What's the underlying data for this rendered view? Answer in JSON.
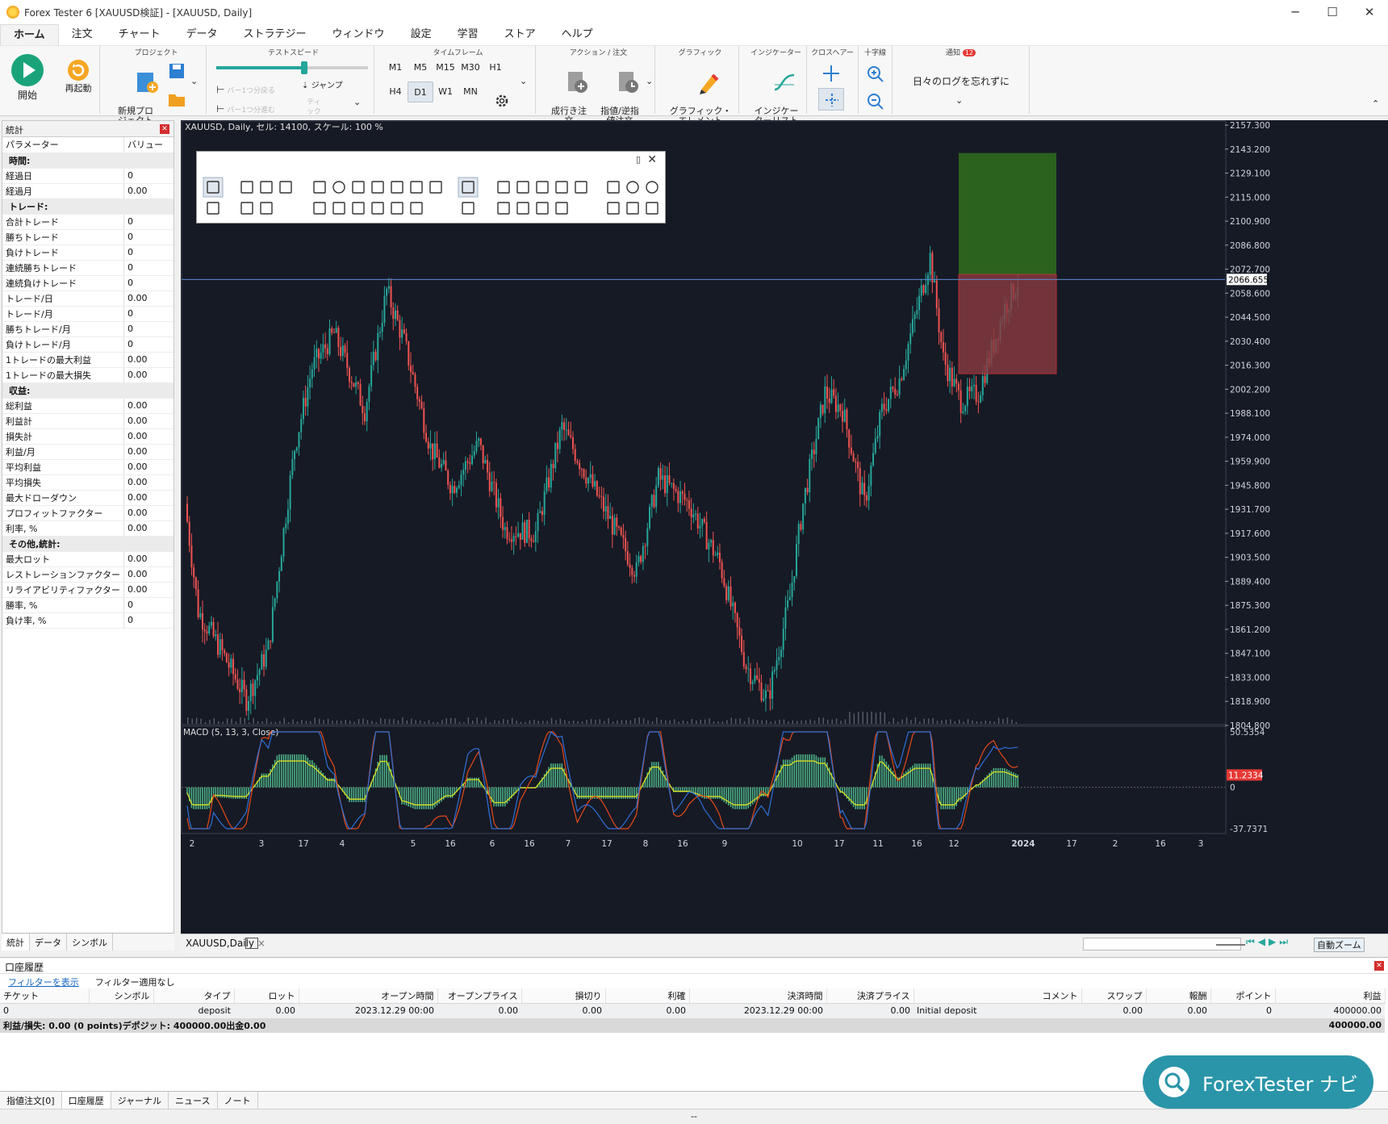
{
  "window": {
    "title": "Forex Tester 6  [XAUUSD検証] - [XAUUSD, Daily]"
  },
  "menu": [
    "ホーム",
    "注文",
    "チャート",
    "データ",
    "ストラテジー",
    "ウィンドウ",
    "設定",
    "学習",
    "ストア",
    "ヘルプ"
  ],
  "ribbon": {
    "start": "開始",
    "restart": "再起動",
    "group_project": "プロジェクト",
    "new_project": "新規プロ\nジェクト",
    "group_speed": "テストスピード",
    "bar_back": "バー1つ分戻る",
    "bar_fwd": "バー1つ分進む",
    "jump": "ジャンプ",
    "tick": "ティ\nック",
    "group_tf": "タイムフレーム",
    "timeframes": [
      "M1",
      "M5",
      "M15",
      "M30",
      "H1",
      "H4",
      "D1",
      "W1",
      "MN"
    ],
    "selected_tf": "D1",
    "group_action": "アクション / 注文",
    "market_order": "成行き注\n文",
    "limit_stop": "指値/逆指\n値注文",
    "group_graphic": "グラフィック",
    "graphic_elements": "グラフィック・\nエレメント",
    "group_indicator": "インジケーター",
    "indicator_list": "インジケー\nターリスト",
    "group_cross": "クロスヘアー",
    "group_crosshair": "十字線",
    "group_notify": "通知",
    "notify_badge": "12",
    "notify_text": "日々のログを忘れずに"
  },
  "stats": {
    "title": "統計",
    "col_param": "パラメーター",
    "col_value": "バリュー",
    "rows": [
      {
        "s": "時間:"
      },
      {
        "p": "経過日",
        "v": "0"
      },
      {
        "p": "経過月",
        "v": "0.00"
      },
      {
        "s": "トレード:"
      },
      {
        "p": "合計トレード",
        "v": "0"
      },
      {
        "p": "勝ちトレード",
        "v": "0"
      },
      {
        "p": "負けトレード",
        "v": "0"
      },
      {
        "p": "連続勝ちトレード",
        "v": "0"
      },
      {
        "p": "連続負けトレード",
        "v": "0"
      },
      {
        "p": "トレード/日",
        "v": "0.00"
      },
      {
        "p": "トレード/月",
        "v": "0"
      },
      {
        "p": "勝ちトレード/月",
        "v": "0"
      },
      {
        "p": "負けトレード/月",
        "v": "0"
      },
      {
        "p": "1トレードの最大利益",
        "v": "0.00"
      },
      {
        "p": "1トレードの最大損失",
        "v": "0.00"
      },
      {
        "s": "収益:"
      },
      {
        "p": "総利益",
        "v": "0.00"
      },
      {
        "p": "利益計",
        "v": "0.00"
      },
      {
        "p": "損失計",
        "v": "0.00"
      },
      {
        "p": "利益/月",
        "v": "0.00"
      },
      {
        "p": "平均利益",
        "v": "0.00"
      },
      {
        "p": "平均損失",
        "v": "0.00"
      },
      {
        "p": "最大ドローダウン",
        "v": "0.00"
      },
      {
        "p": "プロフィットファクター",
        "v": "0.00"
      },
      {
        "p": "利率, %",
        "v": "0.00"
      },
      {
        "s": "その他,統計:"
      },
      {
        "p": "最大ロット",
        "v": "0.00"
      },
      {
        "p": "レストレーションファクター",
        "v": "0.00"
      },
      {
        "p": "リライアビリティファクター",
        "v": "0.00"
      },
      {
        "p": "勝率, %",
        "v": "0"
      },
      {
        "p": "負け率, %",
        "v": "0"
      }
    ],
    "tabs": [
      "統計",
      "データ",
      "シンボル"
    ]
  },
  "chart": {
    "header": "XAUUSD, Daily, セル: 14100, スケール: 100 %",
    "current_price": "2066.655",
    "y_ticks": [
      "2157.300",
      "2143.200",
      "2129.100",
      "2115.000",
      "2100.900",
      "2086.800",
      "2072.700",
      "2058.600",
      "2044.500",
      "2030.400",
      "2016.300",
      "2002.200",
      "1988.100",
      "1974.000",
      "1959.900",
      "1945.800",
      "1931.700",
      "1917.600",
      "1903.500",
      "1889.400",
      "1875.300",
      "1861.200",
      "1847.100",
      "1833.000",
      "1818.900",
      "1804.800"
    ],
    "x_ticks": [
      "2",
      "3",
      "17",
      "4",
      "5",
      "16",
      "6",
      "16",
      "7",
      "17",
      "8",
      "16",
      "9",
      "10",
      "17",
      "11",
      "16",
      "12",
      "2024",
      "17",
      "2",
      "16",
      "3"
    ],
    "macd_label": "MACD (5, 13, 3, Close)",
    "macd_ticks": [
      "50.5354",
      "0",
      "-37.7371"
    ],
    "macd_current": "11.2334",
    "tab": "XAUUSD,Daily",
    "zoom_btn": "自動ズーム",
    "colors": {
      "bg": "#161a25",
      "up": "#26a69a",
      "down": "#ef5350",
      "tp": "#2d6a1e",
      "sl": "#8a3a40",
      "macd": "#2f6fd6",
      "signal": "#e64a19",
      "hist": "#4caf84",
      "yellow": "#e6e61e"
    }
  },
  "history": {
    "title": "口座履歴",
    "filter_link": "フィルターを表示",
    "filter_status": "フィルター適用なし",
    "columns": [
      "チケット",
      "シンボル",
      "タイプ",
      "ロット",
      "オープン時間",
      "オープンプライス",
      "損切り",
      "利確",
      "決済時間",
      "決済プライス",
      "コメント",
      "スワップ",
      "報酬",
      "ポイント",
      "利益"
    ],
    "rows": [
      [
        "0",
        "",
        "deposit",
        "0.00",
        "2023.12.29 00:00",
        "0.00",
        "0.00",
        "0.00",
        "2023.12.29 00:00",
        "0.00",
        "Initial deposit",
        "0.00",
        "0.00",
        "0",
        "400000.00"
      ]
    ],
    "total_label": "利益/損失: 0.00 (0 points)デポジット: 400000.00出金0.00",
    "total_value": "400000.00"
  },
  "bottom_tabs": [
    "指値注文[0]",
    "口座履歴",
    "ジャーナル",
    "ニュース",
    "ノート"
  ],
  "status_text": "--",
  "navi": "ForexTester ナビ"
}
